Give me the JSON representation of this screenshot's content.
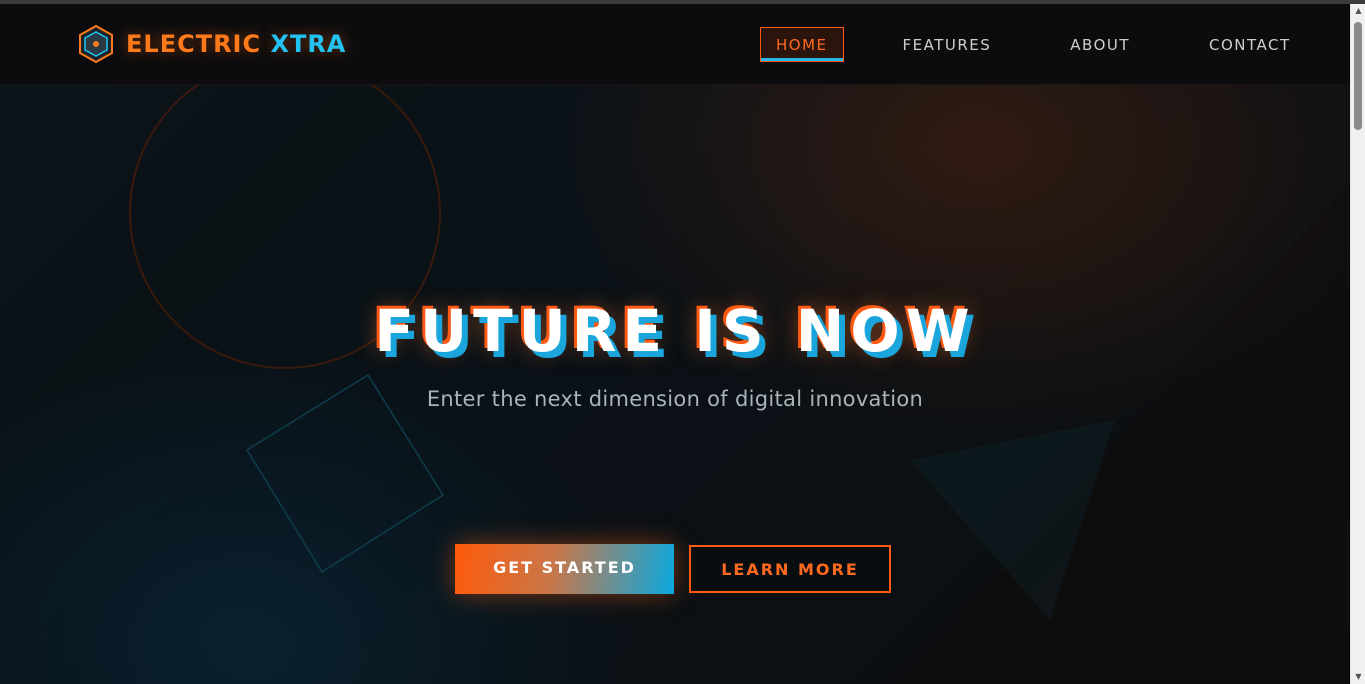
{
  "brand": {
    "word1": "ELECTRIC",
    "word2": "XTRA",
    "icon": "hexagon-logo-icon"
  },
  "nav": {
    "items": [
      {
        "label": "HOME",
        "active": true
      },
      {
        "label": "FEATURES",
        "active": false
      },
      {
        "label": "ABOUT",
        "active": false
      },
      {
        "label": "CONTACT",
        "active": false
      }
    ]
  },
  "hero": {
    "title": "FUTURE IS NOW",
    "subtitle": "Enter the next dimension of digital innovation",
    "primary_button": "GET STARTED",
    "secondary_button": "LEARN MORE"
  },
  "colors": {
    "accent_orange": "#ff5a14",
    "accent_cyan": "#22c3f0",
    "background": "#0a0c0f"
  },
  "scrollbar": {
    "up_icon": "scroll-up-arrow-icon",
    "down_icon": "scroll-down-arrow-icon"
  }
}
